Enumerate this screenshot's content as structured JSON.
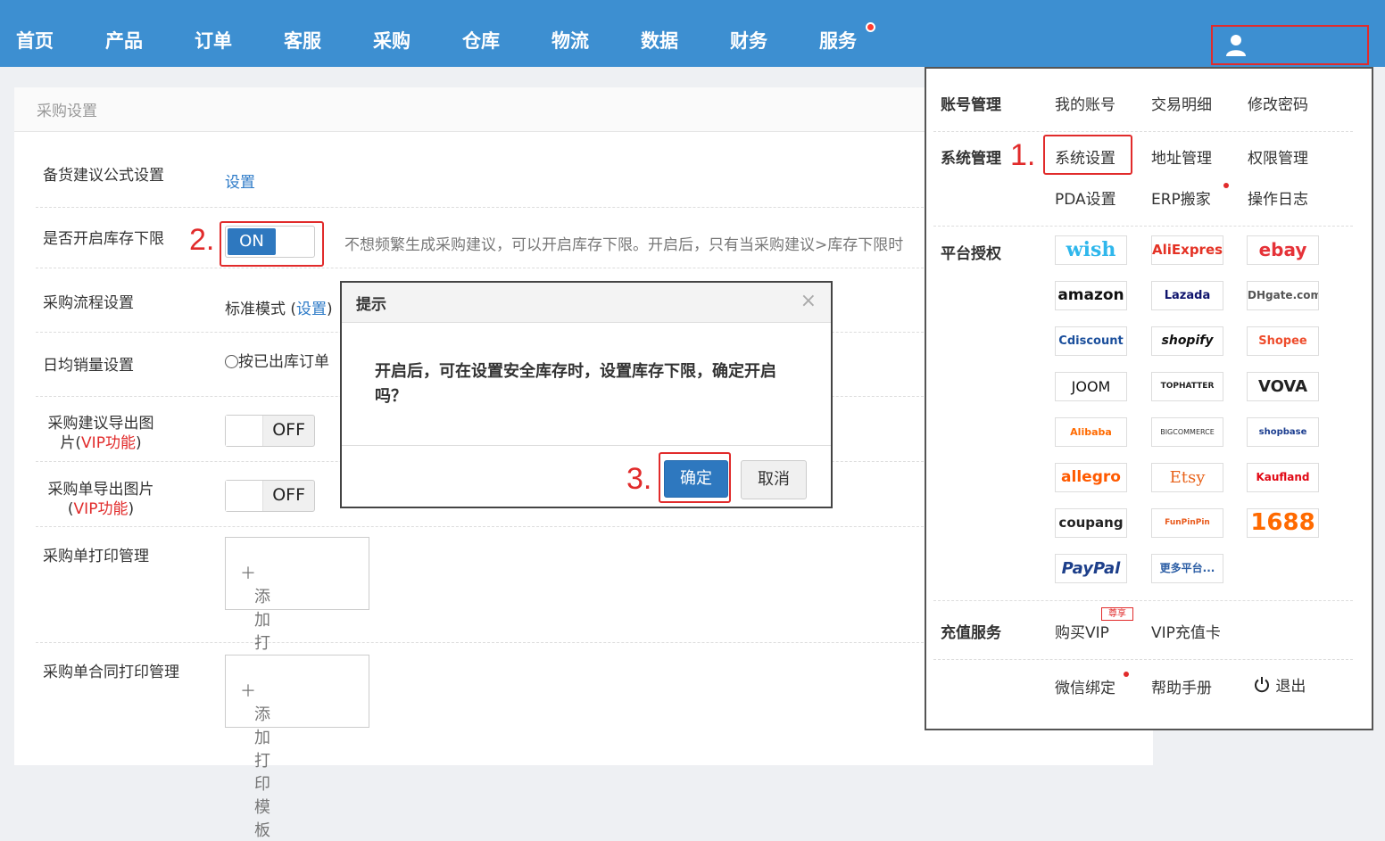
{
  "nav": [
    "首页",
    "产品",
    "订单",
    "客服",
    "采购",
    "仓库",
    "物流",
    "数据",
    "财务",
    "服务"
  ],
  "page": {
    "title": "采购设置",
    "rows": {
      "formula_label": "备货建议公式设置",
      "formula_link": "设置",
      "stock_floor_label": "是否开启库存下限",
      "stock_floor_toggle": "ON",
      "stock_floor_desc": "不想频繁生成采购建议，可以开启库存下限。开启后，只有当采购建议>库存下限时",
      "flow_label": "采购流程设置",
      "flow_mode": "标准模式",
      "flow_link": "设置",
      "daily_label": "日均销量设置",
      "daily_option": "按已出库订单",
      "export_img_label_1": "采购建议导出图",
      "export_img_label_2": "片",
      "order_img_label_1": "采购单导出图片",
      "vip_tag": "VIP功能",
      "off": "OFF",
      "print_label": "采购单打印管理",
      "contract_print_label": "采购单合同打印管理",
      "add_template": "添加打印模板"
    }
  },
  "steps": {
    "one": "1.",
    "two": "2.",
    "three": "3."
  },
  "dialog": {
    "title": "提示",
    "close": "×",
    "message": "开启后，可在设置安全库存时，设置库存下限，确定开启吗？",
    "ok": "确定",
    "cancel": "取消"
  },
  "dropdown": {
    "account": {
      "label": "账号管理",
      "items": [
        "我的账号",
        "交易明细",
        "修改密码"
      ]
    },
    "system": {
      "label": "系统管理",
      "items": [
        "系统设置",
        "地址管理",
        "权限管理",
        "PDA设置",
        "ERP搬家",
        "操作日志"
      ]
    },
    "platform": {
      "label": "平台授权",
      "logos": [
        "wish",
        "AliExpress",
        "ebay",
        "amazon",
        "Lazada",
        "DHgate.com",
        "Cdiscount",
        "shopify",
        "Shopee",
        "JOOM",
        "TOPHATTER",
        "VOVA",
        "Alibaba",
        "BIGCOMMERCE",
        "shopbase",
        "allegro",
        "Etsy",
        "Kaufland",
        "coupang",
        "FunPinPin",
        "1688",
        "PayPal",
        "更多平台..."
      ]
    },
    "recharge": {
      "label": "充值服务",
      "items": [
        "购买VIP",
        "VIP充值卡"
      ],
      "badge": "尊享"
    },
    "misc": [
      "微信绑定",
      "帮助手册",
      "退出"
    ]
  },
  "colors": {
    "topbar": "#3d8fd1",
    "accent": "#2e78bf",
    "highlight": "#e12b2b"
  }
}
